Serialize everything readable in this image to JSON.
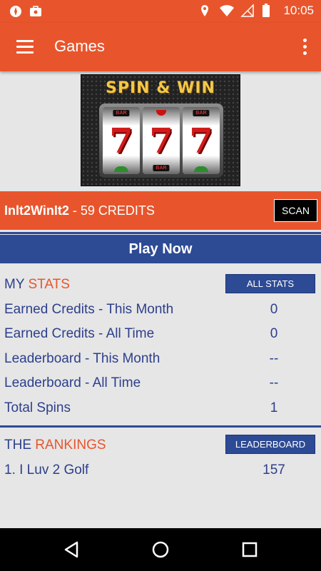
{
  "status_bar": {
    "time": "10:05",
    "left_icons": [
      "compass-icon",
      "briefcase-icon"
    ],
    "right_icons": [
      "location-icon",
      "wifi-icon",
      "no-signal-icon",
      "battery-icon"
    ]
  },
  "app_bar": {
    "title": "Games",
    "menu_icon": "hamburger-menu-icon",
    "overflow_icon": "more-vert-icon"
  },
  "banner": {
    "title": "SPIN & WIN",
    "reels": [
      "7",
      "7",
      "7"
    ],
    "reel_label": "BAR"
  },
  "credits": {
    "username": "Inlt2WinIt2",
    "separator": " - ",
    "credits_text": "59 CREDITS",
    "scan_label": "SCAN"
  },
  "play_now_label": "Play Now",
  "my_stats": {
    "heading_prefix": "MY",
    "heading_accent": "STATS",
    "all_stats_label": "ALL STATS",
    "rows": [
      {
        "label": "Earned Credits - This Month",
        "value": "0"
      },
      {
        "label": "Earned Credits - All Time",
        "value": "0"
      },
      {
        "label": "Leaderboard - This Month",
        "value": "--"
      },
      {
        "label": "Leaderboard - All Time",
        "value": "--"
      },
      {
        "label": "Total Spins",
        "value": "1"
      }
    ]
  },
  "rankings": {
    "heading_prefix": "THE",
    "heading_accent": "RANKINGS",
    "leaderboard_label": "LEADERBOARD",
    "entries": [
      {
        "label": "1. I Luv 2 Golf",
        "value": "157"
      }
    ]
  },
  "nav_bar": {
    "icons": [
      "back-icon",
      "home-icon",
      "recents-icon"
    ]
  },
  "colors": {
    "primary": "#e8552c",
    "accent_blue": "#2d4a94",
    "background": "#e6e6e6"
  }
}
